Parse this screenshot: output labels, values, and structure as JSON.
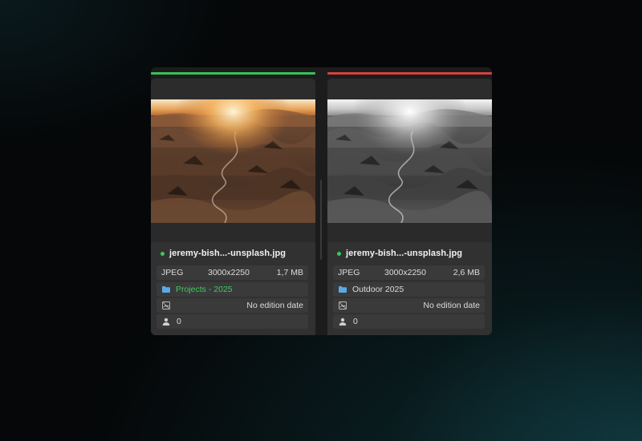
{
  "colors": {
    "left_accent": "#37c157",
    "right_accent": "#d2423f",
    "status_green": "#3ec85a",
    "folder_green": "#40c95d",
    "folder_icon": "#5aa9e6"
  },
  "panels": [
    {
      "filename": "jeremy-bish...-unsplash.jpg",
      "status": "green-dot",
      "format": "JPEG",
      "dimensions": "3000x2250",
      "filesize": "1,7 MB",
      "folder": "Projects - 2025",
      "folder_icon": "folder-icon",
      "edition_date": "No edition date",
      "edition_icon": "no-image-icon",
      "persons": "0",
      "persons_icon": "person-icon",
      "photo_style": "color"
    },
    {
      "filename": "jeremy-bish...-unsplash.jpg",
      "status": "green-dot",
      "format": "JPEG",
      "dimensions": "3000x2250",
      "filesize": "2,6 MB",
      "folder": "Outdoor 2025",
      "folder_icon": "folder-icon",
      "edition_date": "No edition date",
      "edition_icon": "no-image-icon",
      "persons": "0",
      "persons_icon": "person-icon",
      "photo_style": "grayscale"
    }
  ]
}
